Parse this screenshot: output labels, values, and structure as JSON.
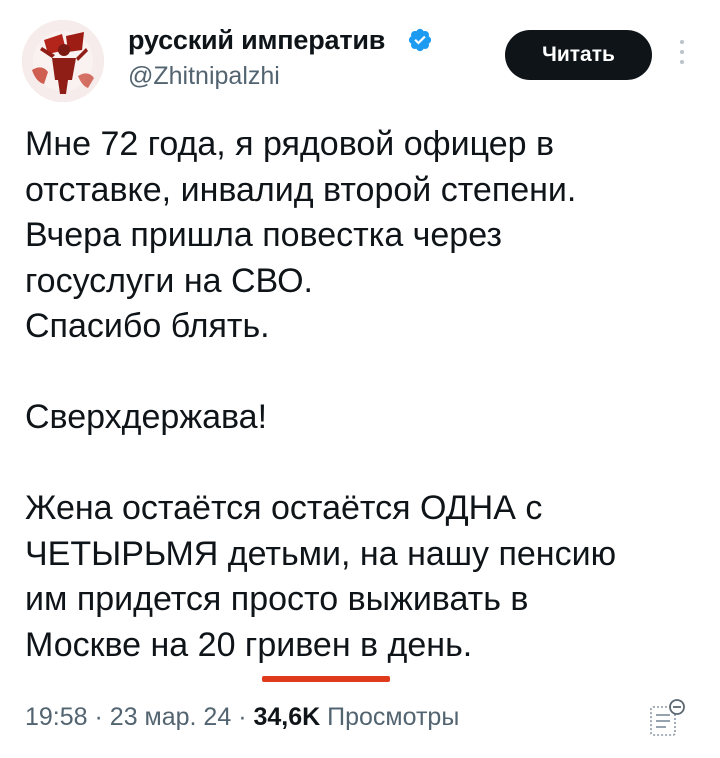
{
  "author": {
    "display_name": "русский императив",
    "handle": "@Zhitnipalzhi",
    "verified": true,
    "avatar_icon": "red-figure-avatar-icon"
  },
  "follow_button_label": "Читать",
  "more_icon": "more-vertical-icon",
  "post_lines": [
    "Мне 72 года, я рядовой офицер в",
    "отставке, инвалид второй степени.",
    "Вчера пришла повестка через",
    "госуслуги на СВО.",
    "Спасибо блять.",
    "",
    "Сверхдержава!",
    "",
    "Жена остаётся остаётся ОДНА с",
    "ЧЕТЫРЬМЯ детьми, на нашу пенсию",
    "им придется просто выживать в",
    "Москве на 20 гривен в день."
  ],
  "meta": {
    "time": "19:58",
    "separator": "·",
    "date": "23 мар. 24",
    "views_count": "34,6K",
    "views_label": "Просмотры"
  },
  "colors": {
    "accent_underline": "#e03a1c",
    "verified_blue": "#1d9bf0",
    "text_primary": "#0f1419",
    "text_secondary": "#536471"
  },
  "translate_icon": "translate-icon"
}
